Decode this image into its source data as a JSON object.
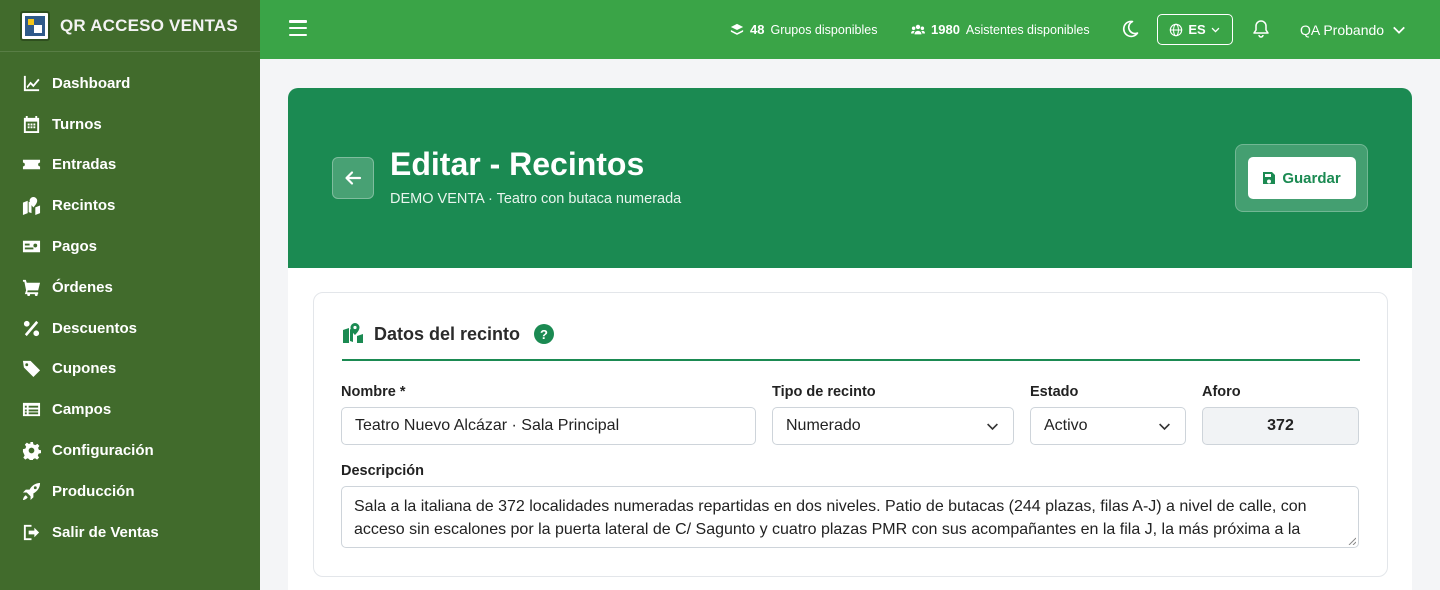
{
  "brand": {
    "title": "QR ACCESO VENTAS"
  },
  "sidebar": {
    "items": [
      {
        "label": "Dashboard",
        "icon": "chart-line-icon"
      },
      {
        "label": "Turnos",
        "icon": "calendar-icon"
      },
      {
        "label": "Entradas",
        "icon": "ticket-icon"
      },
      {
        "label": "Recintos",
        "icon": "map-location-icon"
      },
      {
        "label": "Pagos",
        "icon": "money-bill-icon"
      },
      {
        "label": "Órdenes",
        "icon": "cart-icon"
      },
      {
        "label": "Descuentos",
        "icon": "percent-icon"
      },
      {
        "label": "Cupones",
        "icon": "tags-icon"
      },
      {
        "label": "Campos",
        "icon": "list-icon"
      },
      {
        "label": "Configuración",
        "icon": "gear-icon"
      },
      {
        "label": "Producción",
        "icon": "rocket-icon"
      },
      {
        "label": "Salir de Ventas",
        "icon": "sign-out-icon"
      }
    ]
  },
  "topbar": {
    "groups_count": "48",
    "groups_label": "Grupos disponibles",
    "attendees_count": "1980",
    "attendees_label": "Asistentes disponibles",
    "language": "ES",
    "user_name": "QA Probando"
  },
  "hero": {
    "title": "Editar - Recintos",
    "subtitle": "DEMO VENTA · Teatro con butaca numerada",
    "save_label": "Guardar"
  },
  "form": {
    "section_title": "Datos del recinto",
    "help_label": "?",
    "name_label": "Nombre *",
    "name_value": "Teatro Nuevo Alcázar · Sala Principal",
    "type_label": "Tipo de recinto",
    "type_value": "Numerado",
    "status_label": "Estado",
    "status_value": "Activo",
    "capacity_label": "Aforo",
    "capacity_value": "372",
    "description_label": "Descripción",
    "description_value": "Sala a la italiana de 372 localidades numeradas repartidas en dos niveles. Patio de butacas (244 plazas, filas A-J) a nivel de calle, con acceso sin escalones por la puerta lateral de C/ Sagunto y cuatro plazas PMR con sus acompañantes en la fila J, la más próxima a la"
  },
  "colors": {
    "sidebar": "#416b2c",
    "topbar": "#3aa447",
    "hero": "#1b8a52"
  }
}
